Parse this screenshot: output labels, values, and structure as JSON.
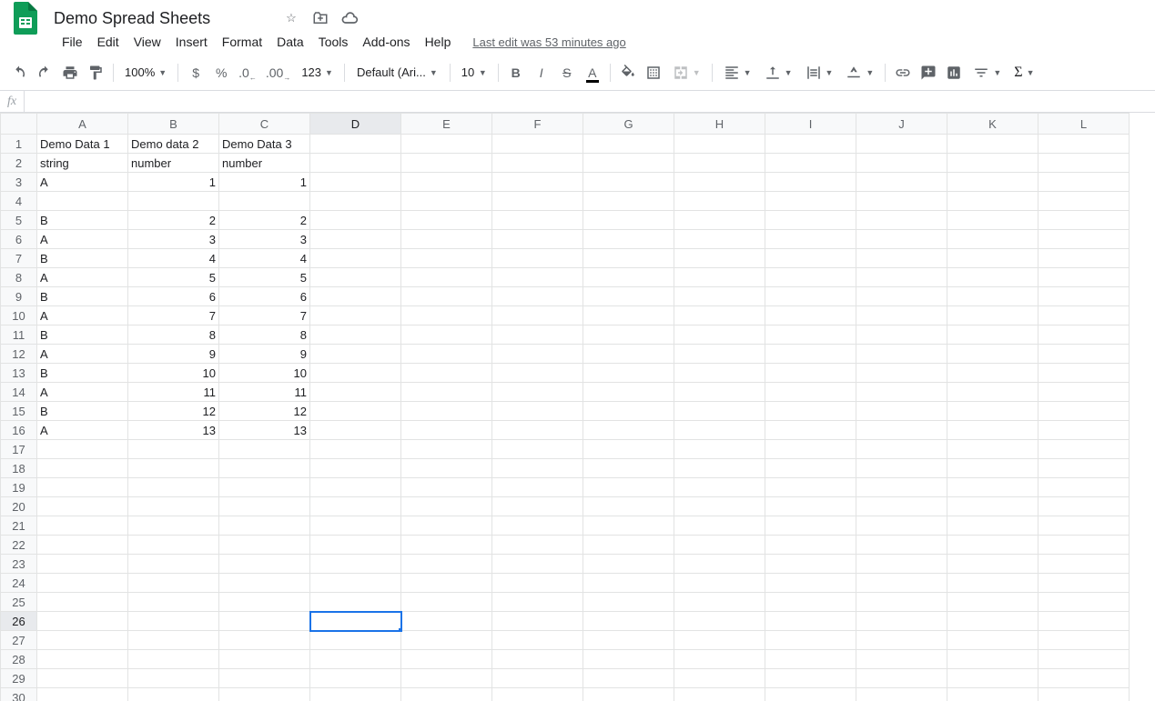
{
  "doc": {
    "title": "Demo Spread Sheets"
  },
  "menu": {
    "file": "File",
    "edit": "Edit",
    "view": "View",
    "insert": "Insert",
    "format": "Format",
    "data": "Data",
    "tools": "Tools",
    "addons": "Add-ons",
    "help": "Help",
    "last_edit": "Last edit was 53 minutes ago"
  },
  "toolbar": {
    "zoom": "100%",
    "font": "Default (Ari...",
    "font_size": "10",
    "currency": "$",
    "percent": "%",
    "dec_less": ".0",
    "dec_more": ".00",
    "num_fmt": "123",
    "bold": "B",
    "italic": "I",
    "strike": "S",
    "textcolor": "A"
  },
  "columns": [
    "A",
    "B",
    "C",
    "D",
    "E",
    "F",
    "G",
    "H",
    "I",
    "J",
    "K",
    "L"
  ],
  "row_count": 30,
  "selected": {
    "row": 26,
    "col": 4
  },
  "cells": {
    "1": {
      "A": {
        "v": "Demo Data 1",
        "t": "text"
      },
      "B": {
        "v": "Demo data 2",
        "t": "text"
      },
      "C": {
        "v": "Demo Data 3",
        "t": "text"
      }
    },
    "2": {
      "A": {
        "v": "string",
        "t": "text"
      },
      "B": {
        "v": "number",
        "t": "text"
      },
      "C": {
        "v": "number",
        "t": "text"
      }
    },
    "3": {
      "A": {
        "v": "A",
        "t": "text"
      },
      "B": {
        "v": "1",
        "t": "num"
      },
      "C": {
        "v": "1",
        "t": "num"
      }
    },
    "5": {
      "A": {
        "v": "B",
        "t": "text"
      },
      "B": {
        "v": "2",
        "t": "num"
      },
      "C": {
        "v": "2",
        "t": "num"
      }
    },
    "6": {
      "A": {
        "v": "A",
        "t": "text"
      },
      "B": {
        "v": "3",
        "t": "num"
      },
      "C": {
        "v": "3",
        "t": "num"
      }
    },
    "7": {
      "A": {
        "v": "B",
        "t": "text"
      },
      "B": {
        "v": "4",
        "t": "num"
      },
      "C": {
        "v": "4",
        "t": "num"
      }
    },
    "8": {
      "A": {
        "v": "A",
        "t": "text"
      },
      "B": {
        "v": "5",
        "t": "num"
      },
      "C": {
        "v": "5",
        "t": "num"
      }
    },
    "9": {
      "A": {
        "v": "B",
        "t": "text"
      },
      "B": {
        "v": "6",
        "t": "num"
      },
      "C": {
        "v": "6",
        "t": "num"
      }
    },
    "10": {
      "A": {
        "v": "A",
        "t": "text"
      },
      "B": {
        "v": "7",
        "t": "num"
      },
      "C": {
        "v": "7",
        "t": "num"
      }
    },
    "11": {
      "A": {
        "v": "B",
        "t": "text"
      },
      "B": {
        "v": "8",
        "t": "num"
      },
      "C": {
        "v": "8",
        "t": "num"
      }
    },
    "12": {
      "A": {
        "v": "A",
        "t": "text"
      },
      "B": {
        "v": "9",
        "t": "num"
      },
      "C": {
        "v": "9",
        "t": "num"
      }
    },
    "13": {
      "A": {
        "v": "B",
        "t": "text"
      },
      "B": {
        "v": "10",
        "t": "num"
      },
      "C": {
        "v": "10",
        "t": "num"
      }
    },
    "14": {
      "A": {
        "v": "A",
        "t": "text"
      },
      "B": {
        "v": "11",
        "t": "num"
      },
      "C": {
        "v": "11",
        "t": "num"
      }
    },
    "15": {
      "A": {
        "v": "B",
        "t": "text"
      },
      "B": {
        "v": "12",
        "t": "num"
      },
      "C": {
        "v": "12",
        "t": "num"
      }
    },
    "16": {
      "A": {
        "v": "A",
        "t": "text"
      },
      "B": {
        "v": "13",
        "t": "num"
      },
      "C": {
        "v": "13",
        "t": "num"
      }
    }
  }
}
